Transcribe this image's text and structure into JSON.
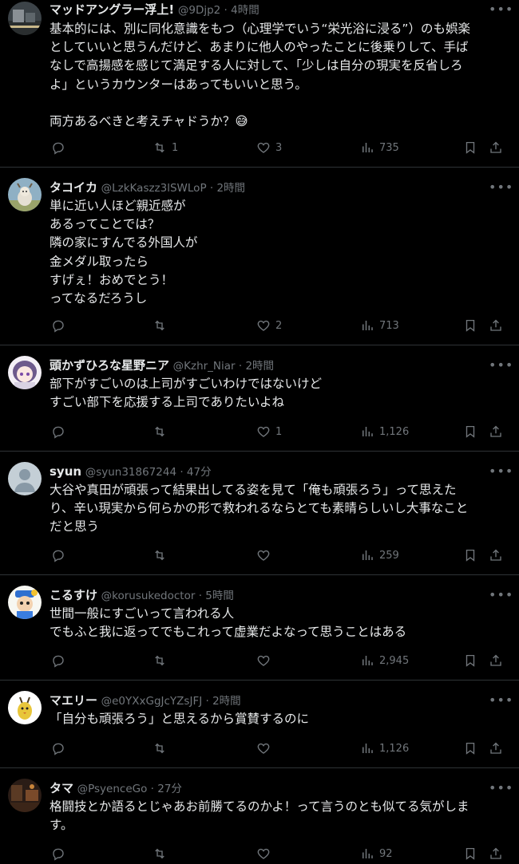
{
  "posts": [
    {
      "name": "マッドアングラー浮上!",
      "meta": "@9Djp2 · 4時間",
      "avatar_icon": "landscape-avatar-icon",
      "lines": [
        "基本的には、別に同化意識をもつ（心理学でいう“栄光浴に浸る”）のも娯楽",
        "としていいと思うんだけど、あまりに他人のやったことに後乗りして、手ば",
        "なしで高揚感を感じて満足する人に対して、「少しは自分の現実を反省しろ",
        "よ」というカウンターはあってもいいと思う。",
        "",
        "両方あるべきと考えチャドうか？😅"
      ],
      "reply_count": "",
      "repost_count": "1",
      "like_count": "3",
      "view_count": "735"
    },
    {
      "name": "タコイカ",
      "meta": "@LzkKaszz3lSWLoP · 2時間",
      "avatar_icon": "goat-avatar-icon",
      "lines": [
        "単に近い人ほど親近感が",
        "あるってことでは？",
        "隣の家にすんでる外国人が",
        "金メダル取ったら",
        "すげぇ！おめでとう！",
        "ってなるだろうし"
      ],
      "reply_count": "",
      "repost_count": "",
      "like_count": "2",
      "view_count": "713"
    },
    {
      "name": "頭かずひろな星野ニア",
      "meta": "@Kzhr_Niar · 2時間",
      "avatar_icon": "anime-girl-avatar-icon",
      "lines": [
        "部下がすごいのは上司がすごいわけではないけど",
        "すごい部下を応援する上司でありたいよね"
      ],
      "reply_count": "",
      "repost_count": "",
      "like_count": "1",
      "view_count": "1,126"
    },
    {
      "name": "syun",
      "meta": "@syun31867244 · 47分",
      "avatar_icon": "default-profile-avatar-icon",
      "lines": [
        "大谷や真田が頑張って結果出してる姿を見て「俺も頑張ろう」って思えた",
        "り、辛い現実から何らかの形で救われるならとても素晴らしいし大事なこと",
        "だと思う"
      ],
      "reply_count": "",
      "repost_count": "",
      "like_count": "",
      "view_count": "259"
    },
    {
      "name": "こるすけ",
      "meta": "@korusukedoctor · 5時間",
      "avatar_icon": "cartoon-character-avatar-icon",
      "lines": [
        "世間一般にすごいって言われる人",
        "でもふと我に返ってでもこれって虚業だよなって思うことはある"
      ],
      "reply_count": "",
      "repost_count": "",
      "like_count": "",
      "view_count": "2,945"
    },
    {
      "name": "マエリー",
      "meta": "@e0YXxGgJcYZsJFJ · 2時間",
      "avatar_icon": "bird-character-avatar-icon",
      "lines": [
        "「自分も頑張ろう」と思えるから賞賛するのに"
      ],
      "reply_count": "",
      "repost_count": "",
      "like_count": "",
      "view_count": "1,126"
    },
    {
      "name": "タマ",
      "meta": "@PsyenceGo · 27分",
      "avatar_icon": "dark-room-avatar-icon",
      "lines": [
        "格闘技とか語るとじゃあお前勝てるのかよ！って言うのとも似てる気がしま",
        "す。"
      ],
      "reply_count": "",
      "repost_count": "",
      "like_count": "",
      "view_count": "92"
    }
  ],
  "icons": {
    "more": "more-options-icon",
    "reply": "reply-icon",
    "repost": "repost-icon",
    "like": "like-heart-icon",
    "views": "views-chart-icon",
    "bookmark": "bookmark-icon",
    "share": "share-icon"
  },
  "colors": {
    "background": "#000000",
    "text": "#e7e9ea",
    "muted": "#71767b",
    "divider": "#2f3336"
  }
}
